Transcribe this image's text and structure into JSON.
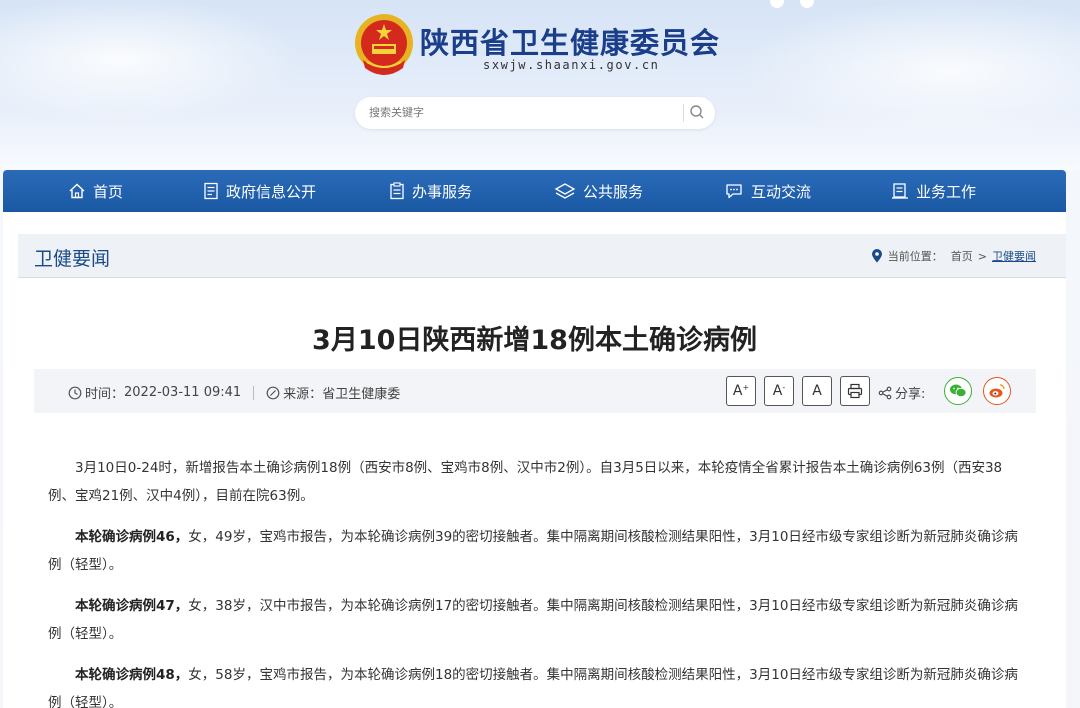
{
  "site": {
    "title": "陕西省卫生健康委员会",
    "domain": "sxwjw.shaanxi.gov.cn"
  },
  "search": {
    "placeholder": "搜索关键字"
  },
  "nav": {
    "items": [
      {
        "label": "首页",
        "icon": "home-icon"
      },
      {
        "label": "政府信息公开",
        "icon": "document-icon"
      },
      {
        "label": "办事服务",
        "icon": "clipboard-icon"
      },
      {
        "label": "公共服务",
        "icon": "layers-icon"
      },
      {
        "label": "互动交流",
        "icon": "chat-icon"
      },
      {
        "label": "业务工作",
        "icon": "briefcase-icon"
      }
    ]
  },
  "section": {
    "title": "卫健要闻"
  },
  "breadcrumb": {
    "prefix": "当前位置：",
    "home": "首页",
    "separator": ">",
    "current": "卫健要闻"
  },
  "article": {
    "title": "3月10日陕西新增18例本土确诊病例",
    "time_label": "时间：",
    "time_value": "2022-03-11 09:41",
    "source_label": "来源：",
    "source_value": "省卫生健康委",
    "tools": {
      "font_up": "A",
      "font_up_sup": "+",
      "font_down": "A",
      "font_down_sup": "-",
      "font_reset": "A"
    },
    "share_label": "分享:",
    "paragraphs": [
      {
        "bold": "",
        "text": "3月10日0-24时，新增报告本土确诊病例18例（西安市8例、宝鸡市8例、汉中市2例）。自3月5日以来，本轮疫情全省累计报告本土确诊病例63例（西安38例、宝鸡21例、汉中4例），目前在院63例。"
      },
      {
        "bold": "本轮确诊病例46，",
        "text": "女，49岁，宝鸡市报告，为本轮确诊病例39的密切接触者。集中隔离期间核酸检测结果阳性，3月10日经市级专家组诊断为新冠肺炎确诊病例（轻型）。"
      },
      {
        "bold": "本轮确诊病例47，",
        "text": "女，38岁，汉中市报告，为本轮确诊病例17的密切接触者。集中隔离期间核酸检测结果阳性，3月10日经市级专家组诊断为新冠肺炎确诊病例（轻型）。"
      },
      {
        "bold": "本轮确诊病例48，",
        "text": "女，58岁，宝鸡市报告，为本轮确诊病例18的密切接触者。集中隔离期间核酸检测结果阳性，3月10日经市级专家组诊断为新冠肺炎确诊病例（轻型）。"
      }
    ]
  },
  "colors": {
    "nav_bg": "#1f5fa9",
    "title_blue": "#1a3e8a",
    "wechat_green": "#3cb034",
    "weibo_orange": "#e8541e"
  }
}
